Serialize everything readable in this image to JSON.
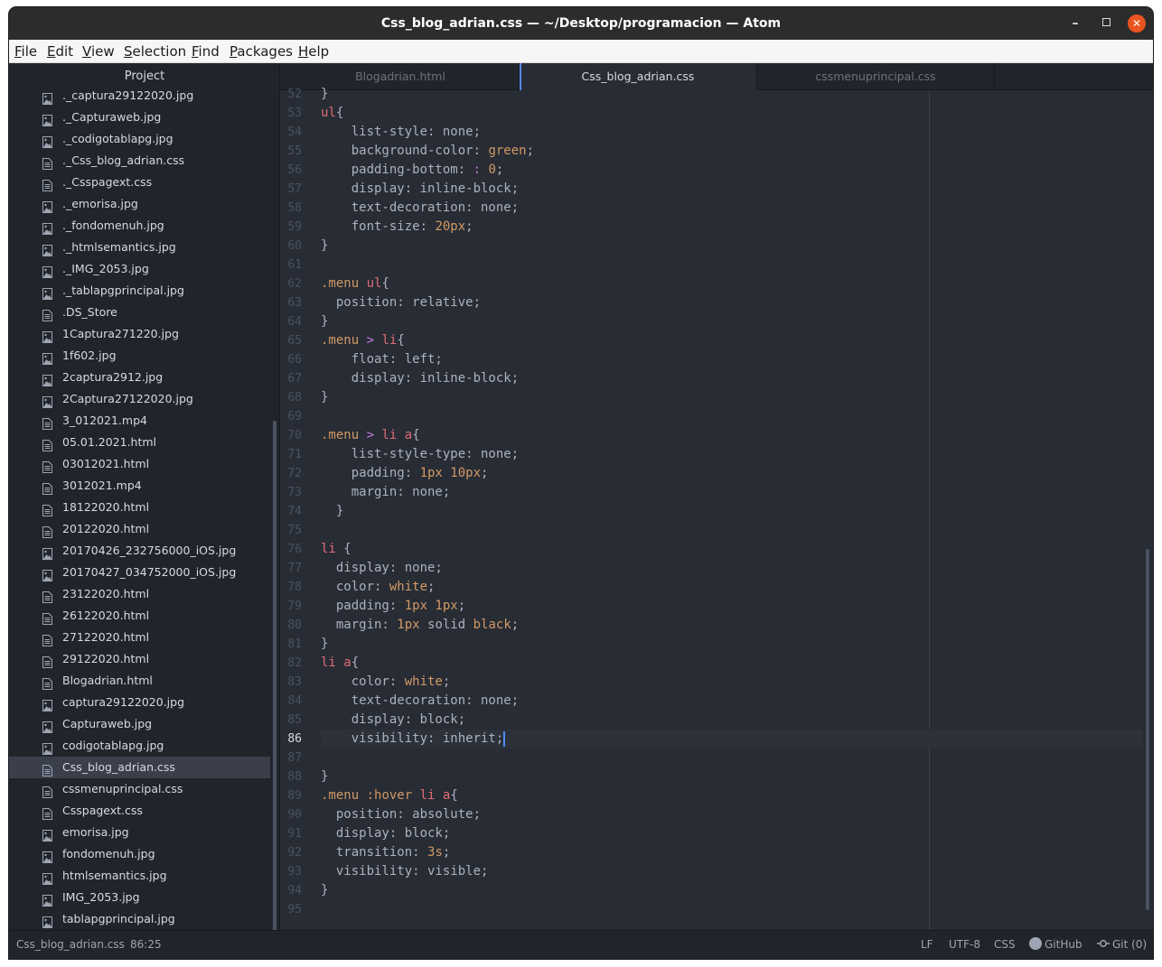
{
  "window": {
    "title": "Css_blog_adrian.css — ~/Desktop/programacion — Atom",
    "minimize_glyph": "–",
    "close_glyph": "✕"
  },
  "menubar": [
    {
      "name": "file",
      "label": "File",
      "underline": "F",
      "rest": "ile"
    },
    {
      "name": "edit",
      "label": "Edit",
      "underline": "E",
      "rest": "dit"
    },
    {
      "name": "view",
      "label": "View",
      "underline": "V",
      "rest": "iew"
    },
    {
      "name": "selection",
      "label": "Selection",
      "underline": "S",
      "rest": "election"
    },
    {
      "name": "find",
      "label": "Find",
      "underline": "F",
      "rest": "ind"
    },
    {
      "name": "packages",
      "label": "Packages",
      "underline": "P",
      "rest": "ackages"
    },
    {
      "name": "help",
      "label": "Help",
      "underline": "H",
      "rest": "elp"
    }
  ],
  "tree": {
    "header": "Project",
    "selected_index": 31,
    "items": [
      {
        "label": "._captura29122020.jpg",
        "icon": "image-file-icon"
      },
      {
        "label": "._Capturaweb.jpg",
        "icon": "image-file-icon"
      },
      {
        "label": "._codigotablapg.jpg",
        "icon": "image-file-icon"
      },
      {
        "label": "._Css_blog_adrian.css",
        "icon": "text-file-icon"
      },
      {
        "label": "._Csspagext.css",
        "icon": "text-file-icon"
      },
      {
        "label": "._emorisa.jpg",
        "icon": "image-file-icon"
      },
      {
        "label": "._fondomenuh.jpg",
        "icon": "image-file-icon"
      },
      {
        "label": "._htmlsemantics.jpg",
        "icon": "image-file-icon"
      },
      {
        "label": "._IMG_2053.jpg",
        "icon": "image-file-icon"
      },
      {
        "label": "._tablapgprincipal.jpg",
        "icon": "image-file-icon"
      },
      {
        "label": ".DS_Store",
        "icon": "text-file-icon"
      },
      {
        "label": "1Captura271220.jpg",
        "icon": "image-file-icon"
      },
      {
        "label": "1f602.jpg",
        "icon": "image-file-icon"
      },
      {
        "label": "2captura2912.jpg",
        "icon": "image-file-icon"
      },
      {
        "label": "2Captura27122020.jpg",
        "icon": "image-file-icon"
      },
      {
        "label": "3_012021.mp4",
        "icon": "text-file-icon"
      },
      {
        "label": "05.01.2021.html",
        "icon": "text-file-icon"
      },
      {
        "label": "03012021.html",
        "icon": "text-file-icon"
      },
      {
        "label": "3012021.mp4",
        "icon": "text-file-icon"
      },
      {
        "label": "18122020.html",
        "icon": "text-file-icon"
      },
      {
        "label": "20122020.html",
        "icon": "text-file-icon"
      },
      {
        "label": "20170426_232756000_iOS.jpg",
        "icon": "image-file-icon"
      },
      {
        "label": "20170427_034752000_iOS.jpg",
        "icon": "image-file-icon"
      },
      {
        "label": "23122020.html",
        "icon": "text-file-icon"
      },
      {
        "label": "26122020.html",
        "icon": "text-file-icon"
      },
      {
        "label": "27122020.html",
        "icon": "text-file-icon"
      },
      {
        "label": "29122020.html",
        "icon": "text-file-icon"
      },
      {
        "label": "Blogadrian.html",
        "icon": "text-file-icon"
      },
      {
        "label": "captura29122020.jpg",
        "icon": "image-file-icon"
      },
      {
        "label": "Capturaweb.jpg",
        "icon": "image-file-icon"
      },
      {
        "label": "codigotablapg.jpg",
        "icon": "image-file-icon"
      },
      {
        "label": "Css_blog_adrian.css",
        "icon": "text-file-icon"
      },
      {
        "label": "cssmenuprincipal.css",
        "icon": "text-file-icon"
      },
      {
        "label": "Csspagext.css",
        "icon": "text-file-icon"
      },
      {
        "label": "emorisa.jpg",
        "icon": "image-file-icon"
      },
      {
        "label": "fondomenuh.jpg",
        "icon": "image-file-icon"
      },
      {
        "label": "htmlsemantics.jpg",
        "icon": "image-file-icon"
      },
      {
        "label": "IMG_2053.jpg",
        "icon": "image-file-icon"
      },
      {
        "label": "tablapgprincipal.jpg",
        "icon": "image-file-icon"
      }
    ]
  },
  "tabs": [
    {
      "label": "Blogadrian.html",
      "active": false
    },
    {
      "label": "Css_blog_adrian.css",
      "active": true
    },
    {
      "label": "cssmenuprincipal.css",
      "active": false
    }
  ],
  "editor": {
    "first_line": 52,
    "cursor_line": 86,
    "colors": {
      "selector": "#e06c75",
      "class": "#d19a66",
      "value": "#d19a66",
      "operator": "#c678dd",
      "text": "#abb2bf",
      "cursor": "#528bff"
    },
    "lines": [
      [
        [
          "p",
          "}"
        ]
      ],
      [
        [
          "s",
          "ul"
        ],
        [
          "p",
          "{"
        ]
      ],
      [
        [
          "p",
          "    list-style: none;"
        ]
      ],
      [
        [
          "p",
          "    background-color: "
        ],
        [
          "v",
          "green"
        ],
        [
          "p",
          ";"
        ]
      ],
      [
        [
          "p",
          "    padding-bottom: "
        ],
        [
          "o",
          ":"
        ],
        [
          "p",
          " "
        ],
        [
          "v",
          "0"
        ],
        [
          "p",
          ";"
        ]
      ],
      [
        [
          "p",
          "    display: inline-block;"
        ]
      ],
      [
        [
          "p",
          "    text-decoration: none;"
        ]
      ],
      [
        [
          "p",
          "    font-size: "
        ],
        [
          "v",
          "20px"
        ],
        [
          "p",
          ";"
        ]
      ],
      [
        [
          "p",
          "}"
        ]
      ],
      [],
      [
        [
          "c",
          ".menu"
        ],
        [
          "p",
          " "
        ],
        [
          "s",
          "ul"
        ],
        [
          "p",
          "{"
        ]
      ],
      [
        [
          "p",
          "  position: relative;"
        ]
      ],
      [
        [
          "p",
          "}"
        ]
      ],
      [
        [
          "c",
          ".menu"
        ],
        [
          "p",
          " "
        ],
        [
          "o",
          ">"
        ],
        [
          "p",
          " "
        ],
        [
          "s",
          "li"
        ],
        [
          "p",
          "{"
        ]
      ],
      [
        [
          "p",
          "    float: left;"
        ]
      ],
      [
        [
          "p",
          "    display: inline-block;"
        ]
      ],
      [
        [
          "p",
          "}"
        ]
      ],
      [],
      [
        [
          "c",
          ".menu"
        ],
        [
          "p",
          " "
        ],
        [
          "o",
          ">"
        ],
        [
          "p",
          " "
        ],
        [
          "s",
          "li a"
        ],
        [
          "p",
          "{"
        ]
      ],
      [
        [
          "p",
          "    list-style-type: none;"
        ]
      ],
      [
        [
          "p",
          "    padding: "
        ],
        [
          "v",
          "1px 10px"
        ],
        [
          "p",
          ";"
        ]
      ],
      [
        [
          "p",
          "    margin: none;"
        ]
      ],
      [
        [
          "p",
          "  }"
        ]
      ],
      [],
      [
        [
          "s",
          "li"
        ],
        [
          "p",
          " {"
        ]
      ],
      [
        [
          "p",
          "  display: none;"
        ]
      ],
      [
        [
          "p",
          "  color: "
        ],
        [
          "v",
          "white"
        ],
        [
          "p",
          ";"
        ]
      ],
      [
        [
          "p",
          "  padding: "
        ],
        [
          "v",
          "1px 1px"
        ],
        [
          "p",
          ";"
        ]
      ],
      [
        [
          "p",
          "  margin: "
        ],
        [
          "v",
          "1px"
        ],
        [
          "p",
          " solid "
        ],
        [
          "v",
          "black"
        ],
        [
          "p",
          ";"
        ]
      ],
      [
        [
          "p",
          "}"
        ]
      ],
      [
        [
          "s",
          "li a"
        ],
        [
          "p",
          "{"
        ]
      ],
      [
        [
          "p",
          "    color: "
        ],
        [
          "v",
          "white"
        ],
        [
          "p",
          ";"
        ]
      ],
      [
        [
          "p",
          "    text-decoration: none;"
        ]
      ],
      [
        [
          "p",
          "    display: block;"
        ]
      ],
      [
        [
          "p",
          "    visibility: inherit;"
        ]
      ],
      [],
      [
        [
          "p",
          "}"
        ]
      ],
      [
        [
          "c",
          ".menu"
        ],
        [
          "p",
          " "
        ],
        [
          "c",
          ":hover"
        ],
        [
          "p",
          " "
        ],
        [
          "s",
          "li a"
        ],
        [
          "p",
          "{"
        ]
      ],
      [
        [
          "p",
          "  position: absolute;"
        ]
      ],
      [
        [
          "p",
          "  display: block;"
        ]
      ],
      [
        [
          "p",
          "  transition: "
        ],
        [
          "v",
          "3s"
        ],
        [
          "p",
          ";"
        ]
      ],
      [
        [
          "p",
          "  visibility: visible;"
        ]
      ],
      [
        [
          "p",
          "}"
        ]
      ],
      []
    ]
  },
  "statusbar": {
    "file": "Css_blog_adrian.css",
    "cursor_pos": "86:25",
    "line_ending": "LF",
    "encoding": "UTF-8",
    "grammar": "CSS",
    "github": "GitHub",
    "git": "Git (0)"
  }
}
